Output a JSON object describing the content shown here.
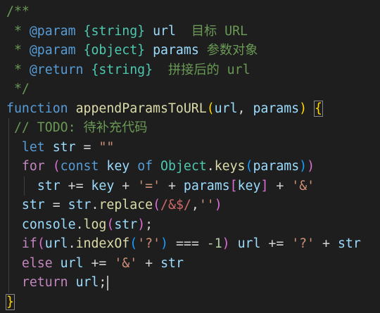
{
  "editor": {
    "lines": [
      {
        "tokens": [
          {
            "t": "/**",
            "c": "cm"
          }
        ]
      },
      {
        "tokens": [
          {
            "t": " * ",
            "c": "cm"
          },
          {
            "t": "@param",
            "c": "tag"
          },
          {
            "t": " ",
            "c": "cm"
          },
          {
            "t": "{string}",
            "c": "typ"
          },
          {
            "t": " ",
            "c": "cm"
          },
          {
            "t": "url",
            "c": "pm"
          },
          {
            "t": "  目标 URL",
            "c": "cm"
          }
        ]
      },
      {
        "tokens": [
          {
            "t": " * ",
            "c": "cm"
          },
          {
            "t": "@param",
            "c": "tag"
          },
          {
            "t": " ",
            "c": "cm"
          },
          {
            "t": "{object}",
            "c": "typ"
          },
          {
            "t": " ",
            "c": "cm"
          },
          {
            "t": "params",
            "c": "pm"
          },
          {
            "t": " 参数对象",
            "c": "cm"
          }
        ]
      },
      {
        "tokens": [
          {
            "t": " * ",
            "c": "cm"
          },
          {
            "t": "@return",
            "c": "tag"
          },
          {
            "t": " ",
            "c": "cm"
          },
          {
            "t": "{string}",
            "c": "typ"
          },
          {
            "t": "  拼接后的 url",
            "c": "cm"
          }
        ]
      },
      {
        "tokens": [
          {
            "t": " */",
            "c": "cm"
          }
        ]
      },
      {
        "tokens": [
          {
            "t": "function",
            "c": "kw"
          },
          {
            "t": " ",
            "c": "op"
          },
          {
            "t": "appendParamsToURL",
            "c": "fn"
          },
          {
            "t": "(",
            "c": "br1"
          },
          {
            "t": "url",
            "c": "pm"
          },
          {
            "t": ", ",
            "c": "op"
          },
          {
            "t": "params",
            "c": "pm"
          },
          {
            "t": ")",
            "c": "br1"
          },
          {
            "t": " ",
            "c": "op"
          },
          {
            "t": "{",
            "c": "br1",
            "box": true
          }
        ]
      },
      {
        "guides": [
          0
        ],
        "tokens": [
          {
            "t": " ",
            "c": "op"
          },
          {
            "t": "// TODO: 待补充代码",
            "c": "cm"
          }
        ]
      },
      {
        "guides": [
          0
        ],
        "tokens": [
          {
            "t": "  ",
            "c": "op"
          },
          {
            "t": "let",
            "c": "kw"
          },
          {
            "t": " ",
            "c": "op"
          },
          {
            "t": "str",
            "c": "var"
          },
          {
            "t": " = ",
            "c": "op"
          },
          {
            "t": "\"\"",
            "c": "str"
          }
        ]
      },
      {
        "guides": [
          0
        ],
        "tokens": [
          {
            "t": "  ",
            "c": "op"
          },
          {
            "t": "for",
            "c": "kwc"
          },
          {
            "t": " ",
            "c": "op"
          },
          {
            "t": "(",
            "c": "br2"
          },
          {
            "t": "const",
            "c": "kw"
          },
          {
            "t": " ",
            "c": "op"
          },
          {
            "t": "key",
            "c": "var"
          },
          {
            "t": " ",
            "c": "op"
          },
          {
            "t": "of",
            "c": "kw"
          },
          {
            "t": " ",
            "c": "op"
          },
          {
            "t": "Object",
            "c": "cls"
          },
          {
            "t": ".",
            "c": "op"
          },
          {
            "t": "keys",
            "c": "fn"
          },
          {
            "t": "(",
            "c": "br3"
          },
          {
            "t": "params",
            "c": "pm"
          },
          {
            "t": ")",
            "c": "br3"
          },
          {
            "t": ")",
            "c": "br2"
          }
        ]
      },
      {
        "guides": [
          0,
          2
        ],
        "tokens": [
          {
            "t": "    ",
            "c": "op"
          },
          {
            "t": "str",
            "c": "var"
          },
          {
            "t": " += ",
            "c": "op"
          },
          {
            "t": "key",
            "c": "var"
          },
          {
            "t": " + ",
            "c": "op"
          },
          {
            "t": "'='",
            "c": "str"
          },
          {
            "t": " + ",
            "c": "op"
          },
          {
            "t": "params",
            "c": "pm"
          },
          {
            "t": "[",
            "c": "br2"
          },
          {
            "t": "key",
            "c": "var"
          },
          {
            "t": "]",
            "c": "br2"
          },
          {
            "t": " + ",
            "c": "op"
          },
          {
            "t": "'&'",
            "c": "str"
          }
        ]
      },
      {
        "guides": [
          0
        ],
        "tokens": [
          {
            "t": "  ",
            "c": "op"
          },
          {
            "t": "str",
            "c": "var"
          },
          {
            "t": " = ",
            "c": "op"
          },
          {
            "t": "str",
            "c": "var"
          },
          {
            "t": ".",
            "c": "op"
          },
          {
            "t": "replace",
            "c": "fn"
          },
          {
            "t": "(",
            "c": "br2"
          },
          {
            "t": "/&$/",
            "c": "reg"
          },
          {
            "t": ",",
            "c": "op"
          },
          {
            "t": "''",
            "c": "str"
          },
          {
            "t": ")",
            "c": "br2"
          }
        ]
      },
      {
        "guides": [
          0
        ],
        "tokens": [
          {
            "t": "  ",
            "c": "op"
          },
          {
            "t": "console",
            "c": "var"
          },
          {
            "t": ".",
            "c": "op"
          },
          {
            "t": "log",
            "c": "fn"
          },
          {
            "t": "(",
            "c": "br2"
          },
          {
            "t": "str",
            "c": "var"
          },
          {
            "t": ")",
            "c": "br2"
          },
          {
            "t": ";",
            "c": "op"
          }
        ]
      },
      {
        "guides": [
          0
        ],
        "tokens": [
          {
            "t": "  ",
            "c": "op"
          },
          {
            "t": "if",
            "c": "kwc"
          },
          {
            "t": "(",
            "c": "br2"
          },
          {
            "t": "url",
            "c": "pm"
          },
          {
            "t": ".",
            "c": "op"
          },
          {
            "t": "indexOf",
            "c": "fn"
          },
          {
            "t": "(",
            "c": "br3"
          },
          {
            "t": "'?'",
            "c": "str"
          },
          {
            "t": ")",
            "c": "br3"
          },
          {
            "t": " === ",
            "c": "op"
          },
          {
            "t": "-1",
            "c": "num"
          },
          {
            "t": ")",
            "c": "br2"
          },
          {
            "t": " ",
            "c": "op"
          },
          {
            "t": "url",
            "c": "pm"
          },
          {
            "t": " += ",
            "c": "op"
          },
          {
            "t": "'?'",
            "c": "str"
          },
          {
            "t": " + ",
            "c": "op"
          },
          {
            "t": "str",
            "c": "var"
          }
        ]
      },
      {
        "guides": [
          0
        ],
        "tokens": [
          {
            "t": "  ",
            "c": "op"
          },
          {
            "t": "else",
            "c": "kwc"
          },
          {
            "t": " ",
            "c": "op"
          },
          {
            "t": "url",
            "c": "pm"
          },
          {
            "t": " += ",
            "c": "op"
          },
          {
            "t": "'&'",
            "c": "str"
          },
          {
            "t": " + ",
            "c": "op"
          },
          {
            "t": "str",
            "c": "var"
          }
        ]
      },
      {
        "guides": [
          0
        ],
        "caret": true,
        "tokens": [
          {
            "t": "  ",
            "c": "op"
          },
          {
            "t": "return",
            "c": "kwc"
          },
          {
            "t": " ",
            "c": "op"
          },
          {
            "t": "url",
            "c": "pm"
          },
          {
            "t": ";",
            "c": "op"
          }
        ]
      },
      {
        "tokens": [
          {
            "t": "}",
            "c": "br1",
            "box": true
          }
        ]
      }
    ]
  }
}
